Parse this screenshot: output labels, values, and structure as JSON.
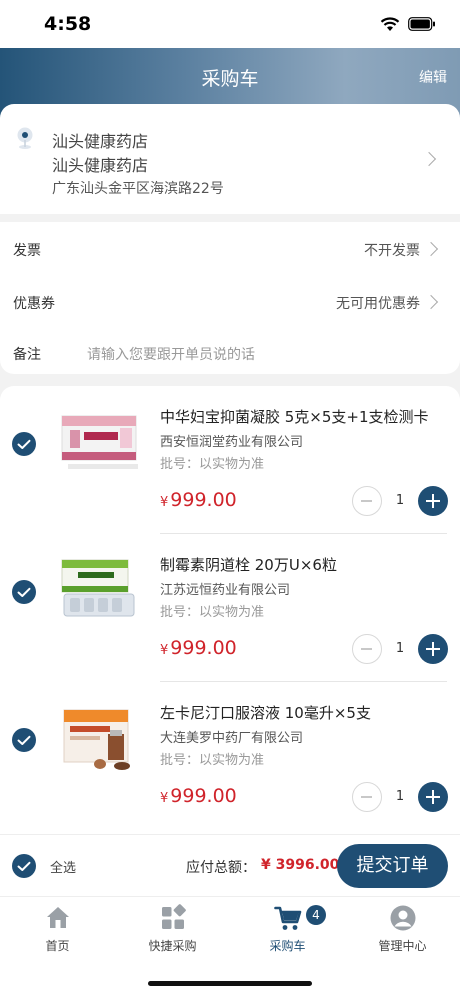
{
  "status": {
    "time": "4:58"
  },
  "header": {
    "title": "采购车",
    "edit_label": "编辑"
  },
  "address": {
    "line1": "汕头健康药店",
    "line2": "汕头健康药店",
    "line3": "广东汕头金平区海滨路22号"
  },
  "options": {
    "invoice_label": "发票",
    "invoice_value": "不开发票",
    "coupon_label": "优惠券",
    "coupon_value": "无可用优惠券",
    "remark_label": "备注",
    "remark_placeholder": "请输入您要跟开单员说的话"
  },
  "products": [
    {
      "title": "中华妇宝抑菌凝胶 5克×5支+1支检测卡",
      "maker": "西安恒润堂药业有限公司",
      "batch": "批号：以实物为准",
      "currency": "¥",
      "price": "999.00",
      "qty": "1",
      "checked": true
    },
    {
      "title": "制霉素阴道栓 20万U×6粒",
      "maker": "江苏远恒药业有限公司",
      "batch": "批号：以实物为准",
      "currency": "¥",
      "price": "999.00",
      "qty": "1",
      "checked": true
    },
    {
      "title": "左卡尼汀口服溶液 10毫升×5支",
      "maker": "大连美罗中药厂有限公司",
      "batch": "批号：以实物为准",
      "currency": "¥",
      "price": "999.00",
      "qty": "1",
      "checked": true
    }
  ],
  "bottom": {
    "select_all_label": "全选",
    "total_label": "应付总额：",
    "total_value": "¥ 3996.00",
    "submit_label": "提交订单"
  },
  "tabs": [
    {
      "label": "首页",
      "icon": "home-icon"
    },
    {
      "label": "快捷采购",
      "icon": "grid-icon"
    },
    {
      "label": "采购车",
      "icon": "cart-icon",
      "badge": "4",
      "active": true
    },
    {
      "label": "管理中心",
      "icon": "user-icon"
    }
  ],
  "colors": {
    "primary": "#1f4e74",
    "price": "#d0242b"
  }
}
